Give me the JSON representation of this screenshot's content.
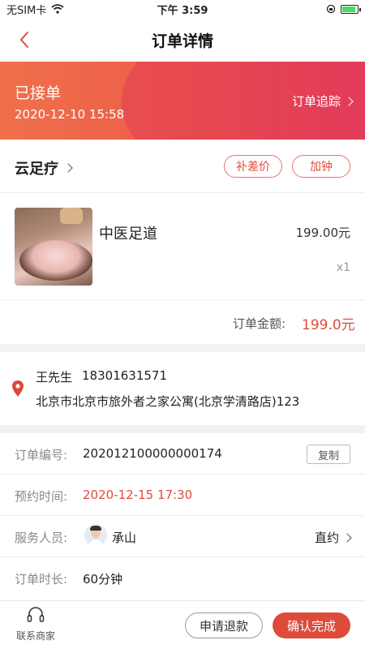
{
  "status_bar": {
    "carrier": "无SIM卡",
    "time": "下午 3:59"
  },
  "nav": {
    "title": "订单详情"
  },
  "banner": {
    "status": "已接单",
    "time": "2020-12-10 15:58",
    "track_label": "订单追踪"
  },
  "shop": {
    "name": "云足疗",
    "diff_price_label": "补差价",
    "add_time_label": "加钟"
  },
  "item": {
    "name": "中医足道",
    "price": "199.00元",
    "quantity": "x1"
  },
  "total": {
    "label": "订单金额:",
    "value": "199.0元"
  },
  "address": {
    "name": "王先生",
    "phone": "18301631571",
    "detail": "北京市北京市旅外者之家公寓(北京学清路店)123"
  },
  "info": {
    "order_no_label": "订单编号:",
    "order_no": "202012100000000174",
    "copy_label": "复制",
    "appointment_label": "预约时间:",
    "appointment_time": "2020-12-15 17:30",
    "staff_label": "服务人员:",
    "staff_name": "承山",
    "direct_label": "直约",
    "duration_label": "订单时长:",
    "duration": "60分钟"
  },
  "bottom": {
    "contact_label": "联系商家",
    "refund_label": "申请退款",
    "confirm_label": "确认完成"
  },
  "colors": {
    "accent": "#e04c3c",
    "banner_start": "#f0704a",
    "banner_end": "#e5465c"
  }
}
